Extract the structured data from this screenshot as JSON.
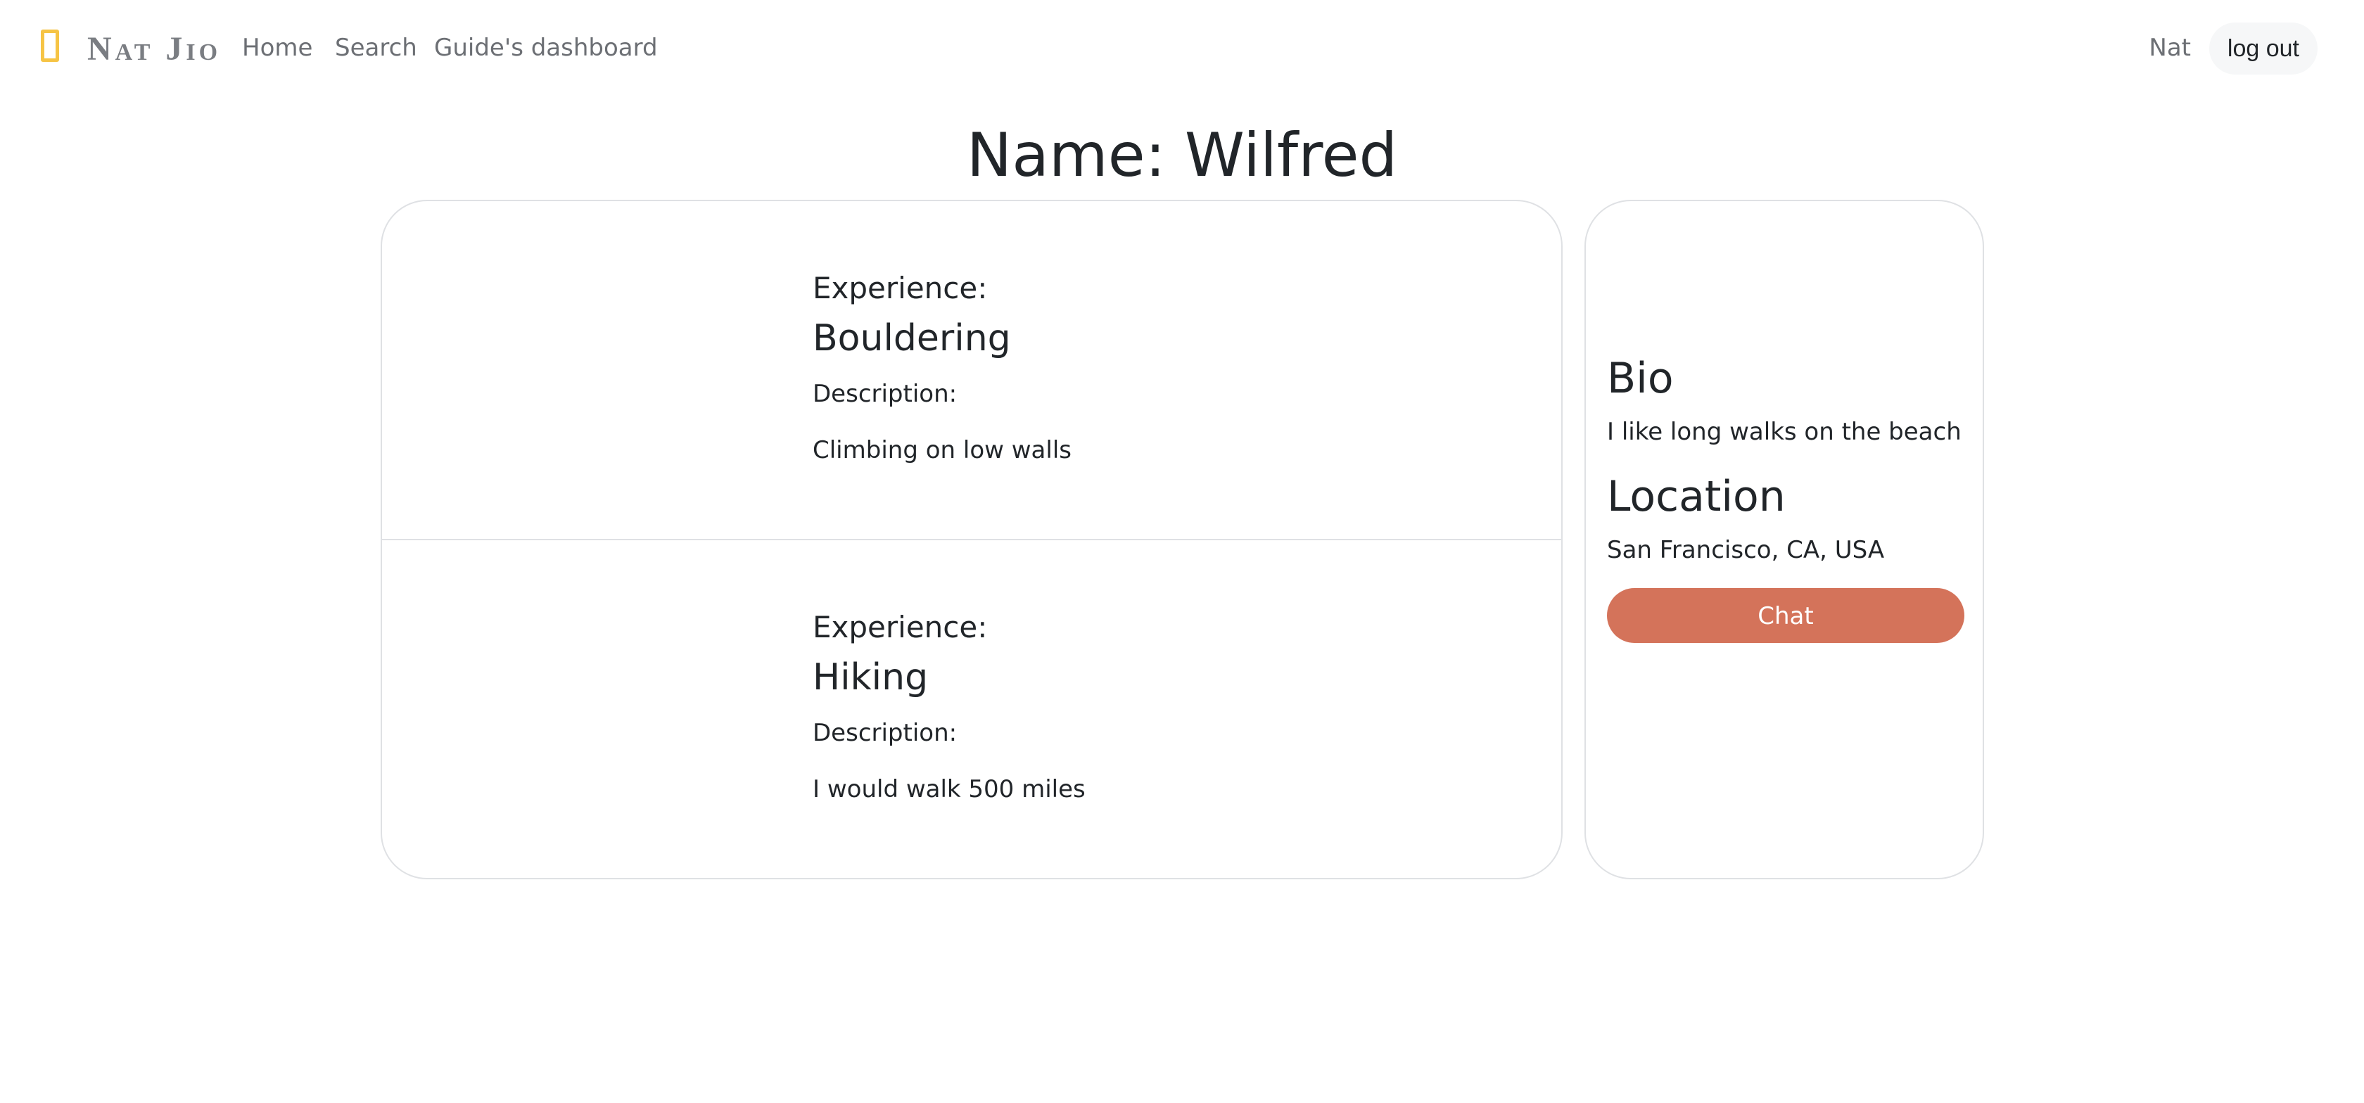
{
  "nav": {
    "brand": "Nat Jio",
    "brand_icon": "book-icon",
    "links": [
      "Home",
      "Search",
      "Guide's dashboard"
    ],
    "user": "Nat",
    "logout": "log out"
  },
  "page": {
    "title": "Name: Wilfred"
  },
  "experiences": [
    {
      "label": "Experience:",
      "name": "Bouldering",
      "description_label": "Description:",
      "description": "Climbing on low walls"
    },
    {
      "label": "Experience:",
      "name": "Hiking",
      "description_label": "Description:",
      "description": "I would walk 500 miles"
    }
  ],
  "profile": {
    "bio_heading": "Bio",
    "bio": "I like long walks on the beach",
    "location_heading": "Location",
    "location": "San Francisco, CA, USA",
    "chat_label": "Chat"
  },
  "colors": {
    "accent": "#d4735a",
    "brand_icon": "#f6c445",
    "border": "#dfe1e4"
  }
}
